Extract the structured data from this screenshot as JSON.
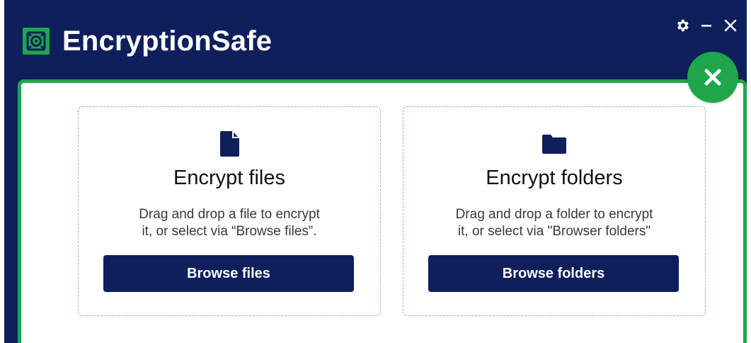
{
  "app": {
    "title": "EncryptionSafe",
    "logo_icon": "vault-icon",
    "colors": {
      "header_bg": "#0f1f5c",
      "accent_green": "#1fa64a",
      "button_bg": "#0f1f5c",
      "button_text": "#ffffff"
    }
  },
  "window_controls": {
    "settings_icon": "gear-icon",
    "minimize_icon": "minimize-icon",
    "close_icon": "close-icon"
  },
  "panel": {
    "close_badge_icon": "close-icon"
  },
  "cards": [
    {
      "icon": "file-icon",
      "title": "Encrypt files",
      "description_line1": "Drag and drop a file to encrypt",
      "description_line2": "it, or select via “Browse files”.",
      "button_label": "Browse files"
    },
    {
      "icon": "folder-icon",
      "title": "Encrypt folders",
      "description_line1": "Drag and drop a folder to encrypt",
      "description_line2": "it, or select via \"Browser folders\"",
      "button_label": "Browse folders"
    }
  ]
}
